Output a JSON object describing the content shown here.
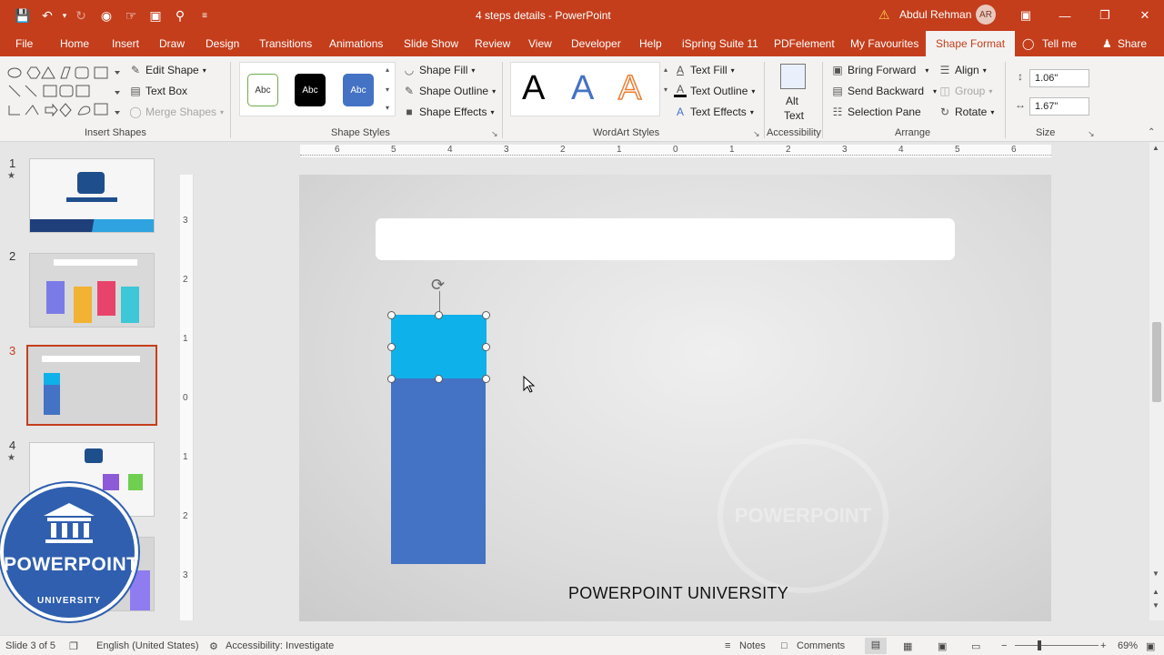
{
  "window": {
    "title": "4 steps details  -  PowerPoint",
    "user_name": "Abdul Rehman",
    "avatar_initials": "AR"
  },
  "tabs": [
    "File",
    "Home",
    "Insert",
    "Draw",
    "Design",
    "Transitions",
    "Animations",
    "Slide Show",
    "Review",
    "View",
    "Developer",
    "Help",
    "iSpring Suite 11",
    "PDFelement",
    "My Favourites",
    "Shape Format",
    "Tell me",
    "Share"
  ],
  "active_tab": "Shape Format",
  "ribbon": {
    "insert_shapes": {
      "edit_shape": "Edit Shape",
      "text_box": "Text Box",
      "merge_shapes": "Merge Shapes",
      "label": "Insert Shapes"
    },
    "shape_styles": {
      "samples": [
        "Abc",
        "Abc",
        "Abc"
      ],
      "shape_fill": "Shape Fill",
      "shape_outline": "Shape Outline",
      "shape_effects": "Shape Effects",
      "label": "Shape Styles"
    },
    "wordart": {
      "letters": [
        "A",
        "A",
        "A"
      ],
      "text_fill": "Text Fill",
      "text_outline": "Text Outline",
      "text_effects": "Text Effects",
      "label": "WordArt Styles"
    },
    "accessibility": {
      "alt_text_1": "Alt",
      "alt_text_2": "Text",
      "label": "Accessibility"
    },
    "arrange": {
      "bring_forward": "Bring Forward",
      "send_backward": "Send Backward",
      "selection_pane": "Selection Pane",
      "align": "Align",
      "group": "Group",
      "rotate": "Rotate",
      "label": "Arrange"
    },
    "size": {
      "height": "1.06\"",
      "width": "1.67\"",
      "label": "Size"
    }
  },
  "rulers": {
    "horizontal": [
      "6",
      "5",
      "4",
      "3",
      "2",
      "1",
      "0",
      "1",
      "2",
      "3",
      "4",
      "5",
      "6"
    ],
    "vertical": [
      "3",
      "2",
      "1",
      "0",
      "1",
      "2",
      "3"
    ]
  },
  "slides": [
    {
      "num": "1",
      "starred": true
    },
    {
      "num": "2",
      "starred": false
    },
    {
      "num": "3",
      "starred": false,
      "selected": true
    },
    {
      "num": "4",
      "starred": true
    }
  ],
  "slide_content": {
    "footer": "POWERPOINT UNIVERSITY",
    "watermark": "POWERPOINT"
  },
  "logo": {
    "title": "POWERPOINT",
    "subtitle": "UNIVERSITY"
  },
  "status": {
    "slide_info": "Slide 3 of 5",
    "language": "English (United States)",
    "accessibility": "Accessibility: Investigate",
    "notes": "Notes",
    "comments": "Comments",
    "zoom": "69%"
  },
  "colors": {
    "accent": "#c43e1c",
    "shape_blue": "#4472c4",
    "shape_cyan": "#0fb1ea"
  }
}
